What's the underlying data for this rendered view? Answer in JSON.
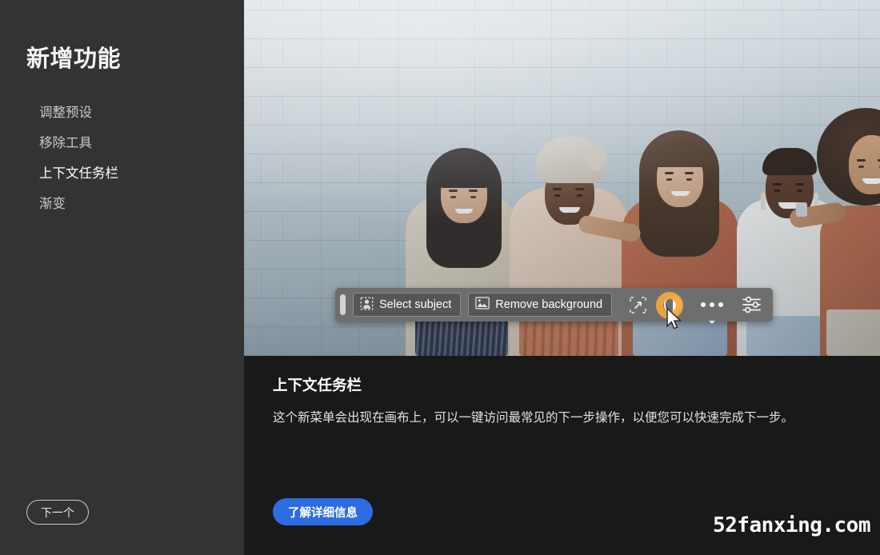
{
  "sidebar": {
    "title": "新增功能",
    "items": [
      {
        "label": "调整预设",
        "active": false
      },
      {
        "label": "移除工具",
        "active": false
      },
      {
        "label": "上下文任务栏",
        "active": true
      },
      {
        "label": "渐变",
        "active": false
      }
    ],
    "next_label": "下一个"
  },
  "hero": {
    "alt": "五位面带笑容的女性并排站在浅蓝灰色砖墙前",
    "wall_color": "#c3cfd6",
    "taskbar": {
      "handle": "drag-handle",
      "buttons": [
        {
          "label": "Select subject",
          "icon": "select-subject-icon"
        },
        {
          "label": "Remove background",
          "icon": "remove-background-icon"
        }
      ],
      "icons": [
        {
          "name": "transform-icon"
        },
        {
          "name": "adjustment-contrast-icon"
        },
        {
          "name": "more-options-icon"
        },
        {
          "name": "properties-sliders-icon"
        }
      ],
      "background_color": "#6e6e6e"
    },
    "cursor": {
      "name": "mouse-pointer",
      "ring_color": "#f2a93b"
    }
  },
  "caption": {
    "title": "上下文任务栏",
    "body": "这个新菜单会出现在画布上，可以一键访问最常见的下一步操作，以便您可以快速完成下一步。"
  },
  "footer": {
    "learn_more_label": "了解详细信息",
    "learn_more_color": "#2d6ce0",
    "watermark": "52fanxing.com"
  }
}
